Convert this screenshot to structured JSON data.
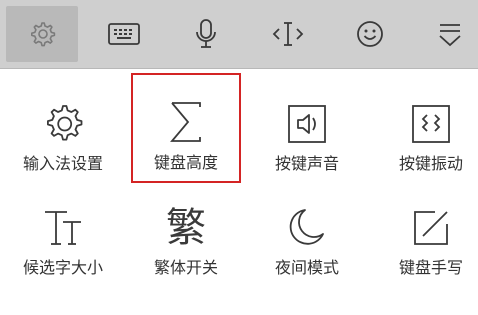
{
  "toolbar": {
    "buttons": [
      {
        "icon": "settings-gear-icon",
        "active": true
      },
      {
        "icon": "keyboard-icon"
      },
      {
        "icon": "microphone-icon"
      },
      {
        "icon": "text-cursor-icon"
      },
      {
        "icon": "emoji-icon"
      },
      {
        "icon": "collapse-keyboard-icon"
      }
    ]
  },
  "panel": {
    "items": [
      {
        "label": "输入法设置",
        "icon": "gear-icon"
      },
      {
        "label": "键盘高度",
        "icon": "sigma-height-icon",
        "highlighted": true
      },
      {
        "label": "按键声音",
        "icon": "speaker-icon"
      },
      {
        "label": "按键振动",
        "icon": "vibrate-icon"
      },
      {
        "label": "候选字大小",
        "icon": "font-size-icon"
      },
      {
        "label": "繁体开关",
        "icon": "traditional-chinese-icon",
        "glyph": "繁"
      },
      {
        "label": "夜间模式",
        "icon": "moon-icon"
      },
      {
        "label": "键盘手写",
        "icon": "handwriting-icon"
      }
    ]
  },
  "colors": {
    "toolbar_bg": "#cfcfcf",
    "active_bg": "#b9b9b9",
    "highlight": "#d42424",
    "icon": "#3a3a3a",
    "label": "#333333"
  }
}
